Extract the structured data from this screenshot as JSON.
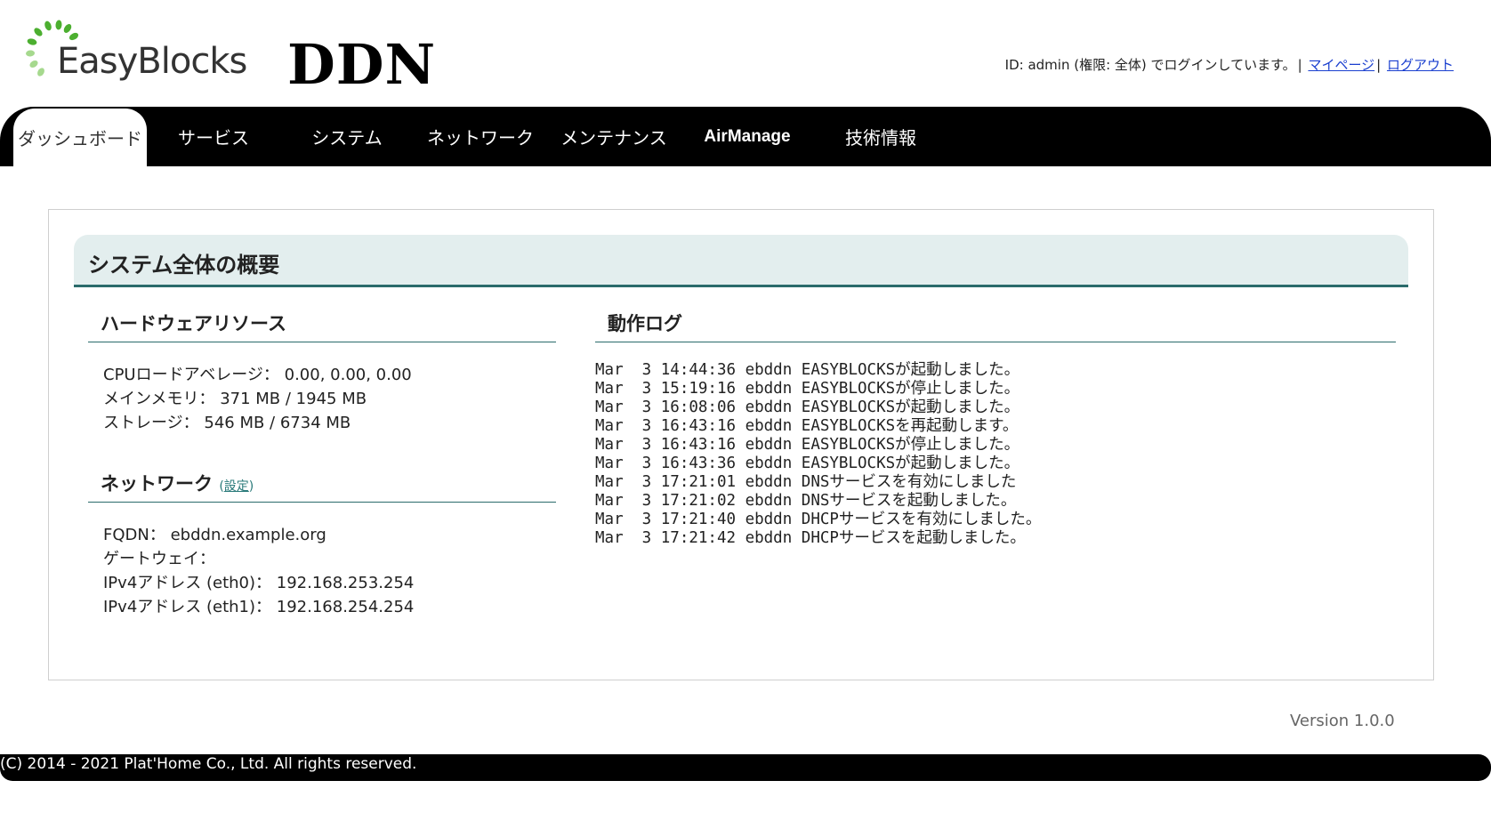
{
  "header": {
    "logo_text": "EasyBlocks",
    "product": "DDN",
    "login_status": "ID: admin (権限: 全体) でログインしています。",
    "mypage_link": "マイページ",
    "logout_link": "ログアウト",
    "logo_color": "#4caf30"
  },
  "nav": {
    "items": [
      {
        "label": "ダッシュボード"
      },
      {
        "label": "サービス"
      },
      {
        "label": "システム"
      },
      {
        "label": "ネットワーク"
      },
      {
        "label": "メンテナンス"
      },
      {
        "label": "AirManage"
      },
      {
        "label": "技術情報"
      }
    ],
    "active": "ダッシュボード"
  },
  "overview": {
    "title": "システム全体の概要",
    "hardware": {
      "title": "ハードウェアリソース",
      "cpu_label": "CPUロードアベレージ：",
      "cpu_value": "0.00, 0.00, 0.00",
      "memory_label": "メインメモリ：",
      "memory_value": "371 MB / 1945 MB",
      "storage_label": "ストレージ：",
      "storage_value": "546 MB / 6734 MB"
    },
    "network": {
      "title": "ネットワーク",
      "settings_open": "(",
      "settings_link": "設定",
      "settings_close": ")",
      "fqdn_label": "FQDN：",
      "fqdn_value": "ebddn.example.org",
      "gateway_label": "ゲートウェイ：",
      "gateway_value": "",
      "eth0_label": "IPv4アドレス (eth0)：",
      "eth0_value": "192.168.253.254",
      "eth1_label": "IPv4アドレス (eth1)：",
      "eth1_value": "192.168.254.254"
    },
    "log": {
      "title": "動作ログ",
      "lines": [
        "Mar  3 14:44:36 ebddn EASYBLOCKSが起動しました。",
        "Mar  3 15:19:16 ebddn EASYBLOCKSが停止しました。",
        "Mar  3 16:08:06 ebddn EASYBLOCKSが起動しました。",
        "Mar  3 16:43:16 ebddn EASYBLOCKSを再起動します。",
        "Mar  3 16:43:16 ebddn EASYBLOCKSが停止しました。",
        "Mar  3 16:43:36 ebddn EASYBLOCKSが起動しました。",
        "Mar  3 17:21:01 ebddn DNSサービスを有効にしました",
        "Mar  3 17:21:02 ebddn DNSサービスを起動しました。",
        "Mar  3 17:21:40 ebddn DHCPサービスを有効にしました。",
        "Mar  3 17:21:42 ebddn DHCPサービスを起動しました。"
      ]
    }
  },
  "version": "Version 1.0.0",
  "footer": "(C) 2014 - 2021 Plat'Home Co., Ltd. All rights reserved."
}
